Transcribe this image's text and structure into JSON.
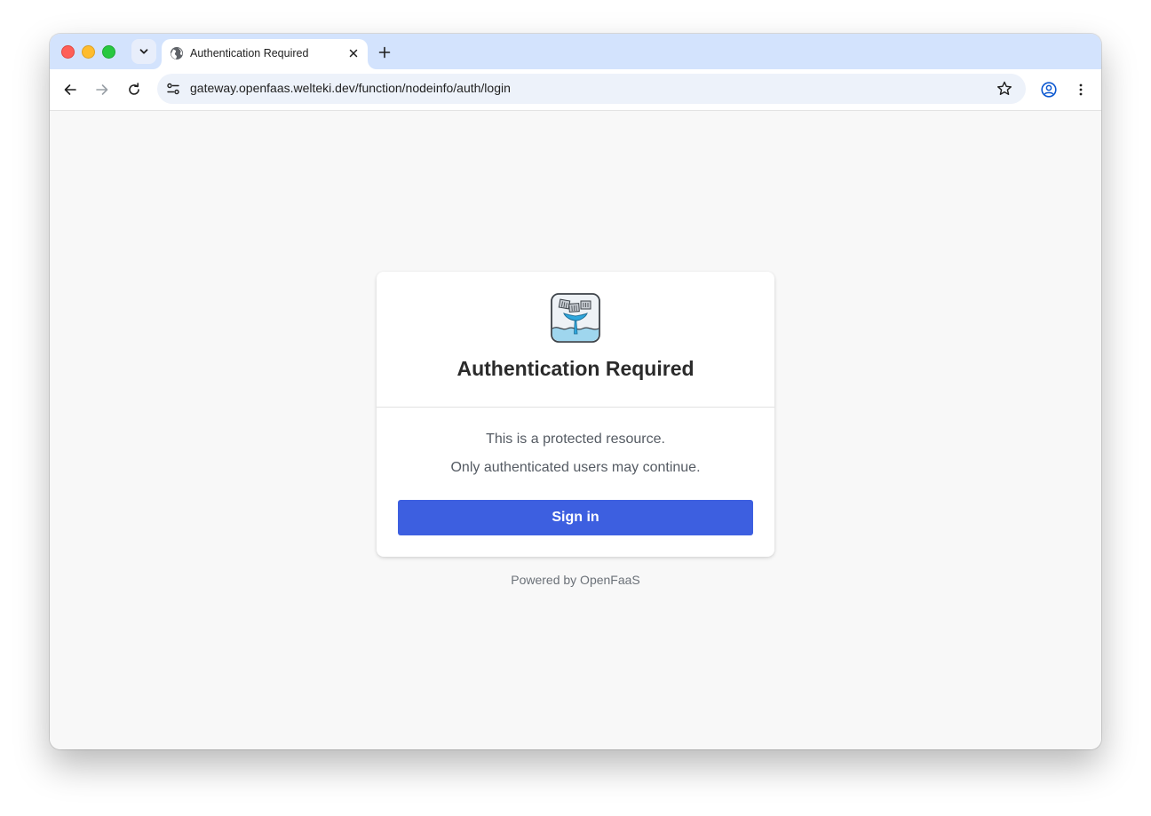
{
  "browser": {
    "tab": {
      "title": "Authentication Required",
      "favicon": "globe-icon"
    },
    "new_tab_symbol": "+",
    "address_bar": {
      "url": "gateway.openfaas.welteki.dev/function/nodeinfo/auth/login"
    },
    "icons": {
      "back": "arrow-left-icon",
      "forward": "arrow-right-icon",
      "reload": "reload-icon",
      "site_settings": "tune-icon",
      "bookmark": "star-icon",
      "profile": "profile-icon",
      "menu": "more-vertical-icon"
    }
  },
  "page": {
    "logo": "openfaas-whale-logo",
    "title": "Authentication Required",
    "message_line1": "This is a protected resource.",
    "message_line2": "Only authenticated users may continue.",
    "signin_label": "Sign in",
    "footer": "Powered by OpenFaaS"
  },
  "colors": {
    "tabstrip": "#d3e3fd",
    "button": "#3d5fe0",
    "page_background": "#f8f8f8"
  }
}
